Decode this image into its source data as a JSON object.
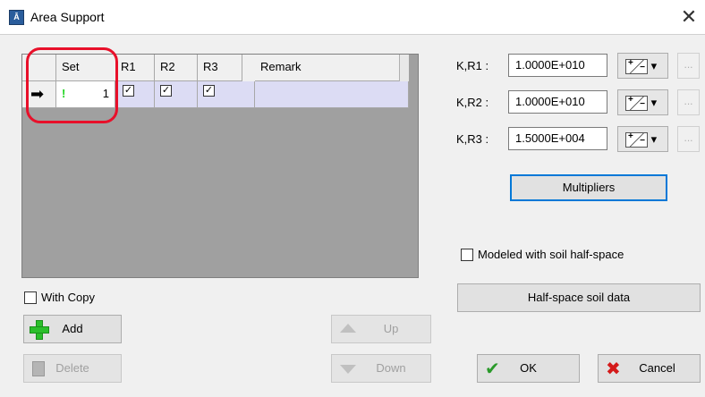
{
  "window": {
    "title": "Area Support",
    "icon": "app-icon",
    "close_glyph": "✕"
  },
  "grid": {
    "columns": [
      "Set",
      "R1",
      "R2",
      "R3",
      "Remark"
    ],
    "rows": [
      {
        "marker": "➡",
        "warn": "!",
        "set": "1",
        "r1": true,
        "r2": true,
        "r3": true,
        "remark": ""
      }
    ]
  },
  "stiffness": [
    {
      "label": "K,R1 :",
      "value": "1.0000E+010"
    },
    {
      "label": "K,R2 :",
      "value": "1.0000E+010"
    },
    {
      "label": "K,R3 :",
      "value": "1.5000E+004"
    }
  ],
  "buttons": {
    "multipliers": "Multipliers",
    "halfspace_data": "Half-space soil data",
    "add": "Add",
    "delete": "Delete",
    "up": "Up",
    "down": "Down",
    "ok": "OK",
    "cancel": "Cancel",
    "dots": "..."
  },
  "checkboxes": {
    "modeled_soil": "Modeled with soil half-space",
    "with_copy": "With Copy"
  },
  "colors": {
    "selected_row": "#dcdcf4",
    "highlight": "#e8102a",
    "focus": "#0078d7"
  }
}
